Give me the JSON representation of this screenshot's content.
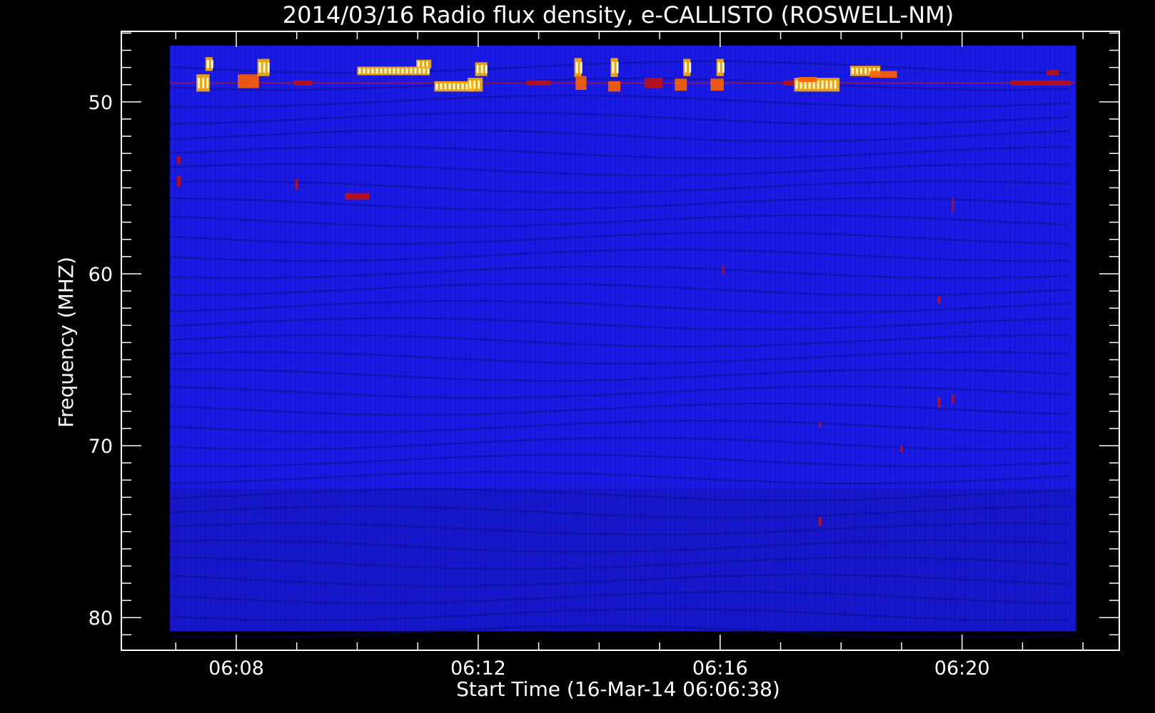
{
  "chart_data": {
    "type": "heatmap",
    "title": "2014/03/16  Radio flux density, e-CALLISTO (ROSWELL-NM)",
    "xlabel": "Start Time (16-Mar-14 06:06:38)",
    "ylabel": "Frequency (MHZ)",
    "x_axis": {
      "unit": "minutes after 06:00",
      "range": [
        6.1,
        22.6
      ],
      "data_range": [
        6.9,
        21.88
      ],
      "major_ticks": [
        {
          "value": 8,
          "label": "06:08"
        },
        {
          "value": 12,
          "label": "06:12"
        },
        {
          "value": 16,
          "label": "06:16"
        },
        {
          "value": 20,
          "label": "06:20"
        }
      ],
      "minor_step": 1
    },
    "y_axis": {
      "unit": "MHz",
      "range": [
        45.9,
        81.9
      ],
      "data_range": [
        44.8,
        80.8
      ],
      "reversed": true,
      "major_ticks": [
        {
          "value": 50,
          "label": "50"
        },
        {
          "value": 60,
          "label": "60"
        },
        {
          "value": 70,
          "label": "70"
        },
        {
          "value": 80,
          "label": "80"
        }
      ],
      "minor_step": 1
    },
    "colormap": {
      "background": "#1a1ae6",
      "low": "#0a0a70",
      "mid": "#c01010",
      "high": "#ffb000",
      "peak": "#ffffe0"
    },
    "horizontal_band": {
      "freq": 48.9,
      "color": "#c01010"
    },
    "bursts": [
      {
        "t": 7.45,
        "f": 48.9,
        "w": 0.22,
        "h": 1.0,
        "i": 1.0
      },
      {
        "t": 7.55,
        "f": 47.8,
        "w": 0.12,
        "h": 0.8,
        "i": 0.9
      },
      {
        "t": 8.2,
        "f": 48.8,
        "w": 0.35,
        "h": 0.8,
        "i": 0.8
      },
      {
        "t": 8.45,
        "f": 48.0,
        "w": 0.2,
        "h": 1.0,
        "i": 0.9
      },
      {
        "t": 9.1,
        "f": 48.9,
        "w": 0.3,
        "h": 0.3,
        "i": 0.5
      },
      {
        "t": 10.6,
        "f": 48.2,
        "w": 1.2,
        "h": 0.5,
        "i": 1.0
      },
      {
        "t": 11.1,
        "f": 47.8,
        "w": 0.25,
        "h": 0.5,
        "i": 1.0
      },
      {
        "t": 11.6,
        "f": 49.1,
        "w": 0.65,
        "h": 0.6,
        "i": 1.0
      },
      {
        "t": 11.95,
        "f": 49.0,
        "w": 0.25,
        "h": 0.8,
        "i": 1.0
      },
      {
        "t": 12.05,
        "f": 48.1,
        "w": 0.2,
        "h": 0.8,
        "i": 0.9
      },
      {
        "t": 13.0,
        "f": 48.9,
        "w": 0.4,
        "h": 0.3,
        "i": 0.5
      },
      {
        "t": 13.65,
        "f": 48.0,
        "w": 0.12,
        "h": 1.1,
        "i": 0.9
      },
      {
        "t": 13.7,
        "f": 48.9,
        "w": 0.18,
        "h": 0.8,
        "i": 0.8
      },
      {
        "t": 14.25,
        "f": 48.0,
        "w": 0.12,
        "h": 1.1,
        "i": 0.9
      },
      {
        "t": 14.25,
        "f": 49.1,
        "w": 0.2,
        "h": 0.6,
        "i": 0.7
      },
      {
        "t": 14.9,
        "f": 48.9,
        "w": 0.3,
        "h": 0.6,
        "i": 0.6
      },
      {
        "t": 15.45,
        "f": 48.0,
        "w": 0.12,
        "h": 1.0,
        "i": 0.9
      },
      {
        "t": 15.35,
        "f": 49.0,
        "w": 0.2,
        "h": 0.7,
        "i": 0.8
      },
      {
        "t": 16.0,
        "f": 48.0,
        "w": 0.12,
        "h": 1.0,
        "i": 0.9
      },
      {
        "t": 15.95,
        "f": 49.0,
        "w": 0.22,
        "h": 0.7,
        "i": 0.8
      },
      {
        "t": 17.3,
        "f": 48.9,
        "w": 0.5,
        "h": 0.3,
        "i": 0.5
      },
      {
        "t": 17.6,
        "f": 49.0,
        "w": 0.75,
        "h": 0.8,
        "i": 1.0
      },
      {
        "t": 17.45,
        "f": 48.7,
        "w": 0.3,
        "h": 0.3,
        "i": 0.8
      },
      {
        "t": 18.4,
        "f": 48.2,
        "w": 0.5,
        "h": 0.6,
        "i": 1.0
      },
      {
        "t": 18.7,
        "f": 48.4,
        "w": 0.45,
        "h": 0.4,
        "i": 0.8
      },
      {
        "t": 21.3,
        "f": 48.9,
        "w": 1.0,
        "h": 0.3,
        "i": 0.55
      },
      {
        "t": 21.5,
        "f": 48.3,
        "w": 0.2,
        "h": 0.3,
        "i": 0.6
      },
      {
        "t": 10.0,
        "f": 55.5,
        "w": 0.4,
        "h": 0.4,
        "i": 0.55
      },
      {
        "t": 7.05,
        "f": 54.6,
        "w": 0.06,
        "h": 0.6,
        "i": 0.6
      },
      {
        "t": 7.05,
        "f": 53.4,
        "w": 0.06,
        "h": 0.4,
        "i": 0.4
      },
      {
        "t": 19.62,
        "f": 61.5,
        "w": 0.05,
        "h": 0.4,
        "i": 0.55
      },
      {
        "t": 19.62,
        "f": 67.5,
        "w": 0.05,
        "h": 0.6,
        "i": 0.65
      },
      {
        "t": 19.85,
        "f": 67.3,
        "w": 0.04,
        "h": 0.5,
        "i": 0.55
      },
      {
        "t": 19.85,
        "f": 56.0,
        "w": 0.03,
        "h": 0.8,
        "i": 0.45
      },
      {
        "t": 17.65,
        "f": 74.4,
        "w": 0.05,
        "h": 0.5,
        "i": 0.5
      },
      {
        "t": 17.65,
        "f": 68.8,
        "w": 0.04,
        "h": 0.3,
        "i": 0.4
      },
      {
        "t": 16.05,
        "f": 59.8,
        "w": 0.03,
        "h": 0.5,
        "i": 0.45
      },
      {
        "t": 19.0,
        "f": 70.2,
        "w": 0.04,
        "h": 0.4,
        "i": 0.45
      },
      {
        "t": 9.0,
        "f": 54.8,
        "w": 0.04,
        "h": 0.6,
        "i": 0.4
      }
    ]
  }
}
